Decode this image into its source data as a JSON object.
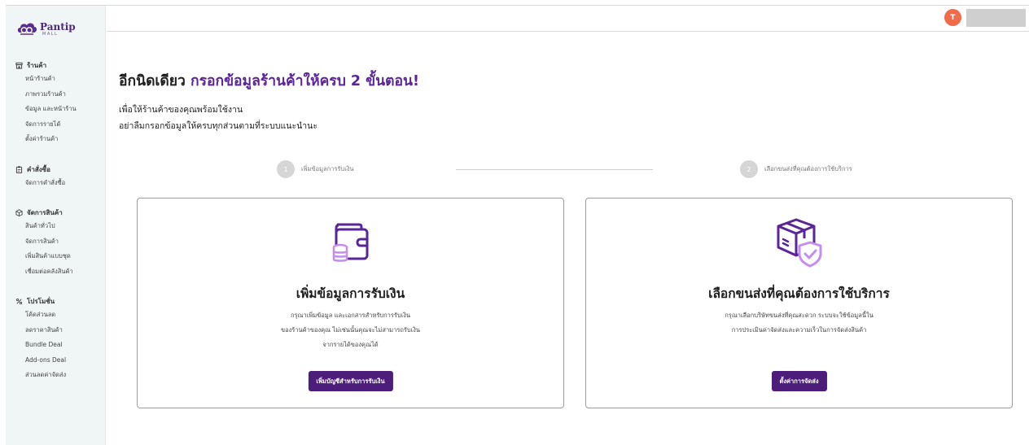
{
  "brand": {
    "name": "Pantip",
    "sub": "MALL"
  },
  "sidebar": {
    "sections": [
      {
        "title": "ร้านค้า",
        "icon": "store-icon",
        "items": [
          "หน้าร้านค้า",
          "ภาพรวมร้านค้า",
          "ข้อมูล และหน้าร้าน",
          "จัดการรายได้",
          "ตั้งค่าร้านค้า"
        ]
      },
      {
        "title": "คำสั่งซื้อ",
        "icon": "clipboard-icon",
        "items": [
          "จัดการคำสั่งซื้อ"
        ]
      },
      {
        "title": "จัดการสินค้า",
        "icon": "box-icon",
        "items": [
          "สินค้าทั่วไป",
          "จัดการสินค้า",
          "เพิ่มสินค้าแบบชุด",
          "เชื่อมต่อคลังสินค้า"
        ]
      },
      {
        "title": "โปรโมชั่น",
        "icon": "percent-icon",
        "items": [
          "โค้ดส่วนลด",
          "ลดราคาสินค้า",
          "Bundle Deal",
          "Add-ons Deal",
          "ส่วนลดค่าจัดส่ง"
        ]
      }
    ]
  },
  "topbar": {
    "avatar_initial": "T"
  },
  "main": {
    "title_prefix": "อีกนิดเดียว",
    "title_accent": "กรอกข้อมูลร้านค้าให้ครบ 2 ขั้นตอน!",
    "subtitle_line1": "เพื่อให้ร้านค้าของคุณพร้อมใช้งาน",
    "subtitle_line2": "อย่าลืมกรอกข้อมูลให้ครบทุกส่วนตามที่ระบบแนะนำนะ",
    "steps": [
      {
        "num": "1",
        "label": "เพิ่มข้อมูลการรับเงิน"
      },
      {
        "num": "2",
        "label": "เลือกขนส่งที่คุณต้องการใช้บริการ"
      }
    ],
    "cards": [
      {
        "title": "เพิ่มข้อมูลการรับเงิน",
        "desc": [
          "กรุณาเพิ่มข้อมูล และเอกสารสำหรับการรับเงิน",
          "ของร้านค้าของคุณ ไม่เช่นนั้นคุณจะไม่สามารถรับเงิน",
          "จากรายได้ของคุณได้"
        ],
        "button": "เพิ่มบัญชีสำหรับการรับเงิน",
        "icon": "wallet-coins-icon"
      },
      {
        "title": "เลือกขนส่งที่คุณต้องการใช้บริการ",
        "desc": [
          "กรุณาเลือกบริษัทขนส่งที่คุณสะดวก ระบบจะใช้ข้อมูลนี้ใน",
          "การประเมินค่าจัดส่งและความเร็วในการจัดส่งสินค้า"
        ],
        "button": "ตั้งค่าการจัดส่ง",
        "icon": "package-shield-icon"
      }
    ]
  },
  "colors": {
    "accent": "#5a2596",
    "button": "#4d1d7b",
    "icon_light": "#c48ef0",
    "avatar": "#ef6b4a",
    "sidebar_bg": "#f0f5f5"
  }
}
